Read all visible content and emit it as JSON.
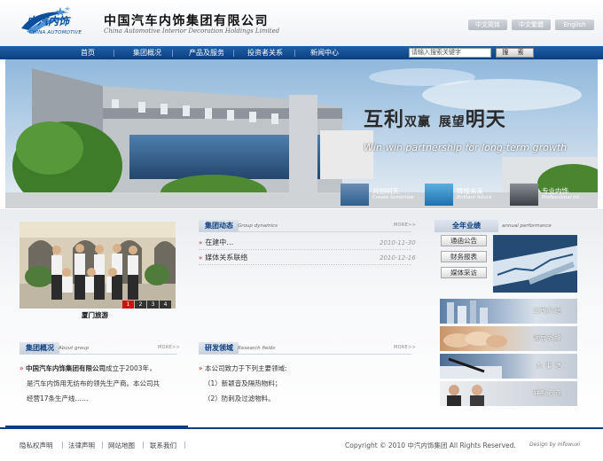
{
  "header": {
    "logo_cn": "中汽内饰",
    "logo_en": "CHINA AUTOMOTIVE",
    "company_cn": "中国汽车内饰集团有限公司",
    "company_en": "China Automotive Interior Decoration Holdings Limited",
    "languages": [
      "中文简体",
      "中文繁體",
      "English"
    ]
  },
  "nav": {
    "items": [
      "首页",
      "集团概况",
      "产品及服务",
      "投资者关系",
      "新闻中心"
    ],
    "search_placeholder": "请输入搜索关键字",
    "search_button": "搜 索"
  },
  "banner": {
    "slogan_cn_1": "互利",
    "slogan_cn_2": "双赢",
    "slogan_cn_3": "展望",
    "slogan_cn_4": "明天",
    "slogan_en": "Win-win partnership for long-term growth",
    "tabs": [
      {
        "title": "共创明天",
        "subtitle": "Create tomorrow"
      },
      {
        "title": "辉煌未来",
        "subtitle": "Brilliant future"
      },
      {
        "title": "专业内饰",
        "subtitle": "Professional Int..."
      }
    ]
  },
  "photo": {
    "caption": "厦门旅游",
    "pages": [
      "1",
      "2",
      "3",
      "4"
    ],
    "active_page": 1
  },
  "group_dynamics": {
    "title": "集团动态",
    "subtitle": "Group dynamics",
    "more": "MORE>>",
    "items": [
      {
        "title": "在建中…",
        "date": "2010-11-30"
      },
      {
        "title": "媒体关系联络",
        "date": "2010-12-16"
      }
    ]
  },
  "about": {
    "title": "集团概况",
    "subtitle": "About group",
    "more": "MORE>>",
    "company_bold": "中国汽车内饰集团有限公司",
    "line1_rest": "成立于2003年，",
    "line2": "是汽车内饰用无纺布的领先生产商。本公司共",
    "line3": "经营17条生产线……"
  },
  "research": {
    "title": "研发领域",
    "subtitle": "Research fields",
    "more": "MORE>>",
    "intro": "本公司致力于下列主要领域:",
    "items": [
      "（1）新颖音及隔热物料；",
      "（2）防刺及过滤物料。"
    ]
  },
  "annual": {
    "title": "全年业绩",
    "subtitle": "annual performance",
    "buttons": [
      "通函公告",
      "财务报表",
      "媒体采访"
    ]
  },
  "right_buttons": [
    "公司介绍",
    "领导致辞",
    "大 事 记",
    "联系方式"
  ],
  "footer": {
    "links": [
      "隐私权声明",
      "法律声明",
      "网站地图",
      "联系我们"
    ],
    "copyright": "Copyright © 2010  中汽内饰集团  All Rights Reserved.",
    "design": "Design by Infowuxi"
  },
  "colors": {
    "nav_blue": "#0b3f80",
    "accent_red": "#c01313",
    "active_page": "#d01010"
  }
}
